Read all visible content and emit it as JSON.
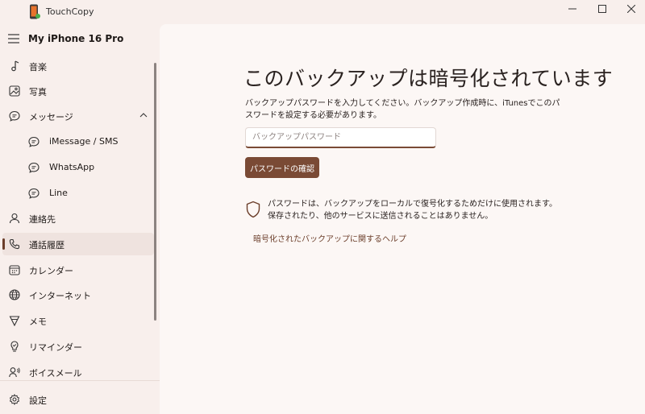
{
  "app": {
    "title": "TouchCopy"
  },
  "sidebar": {
    "device_name": "My iPhone 16 Pro",
    "items": [
      {
        "label": "音楽",
        "icon": "music-note-icon"
      },
      {
        "label": "写真",
        "icon": "photo-icon"
      },
      {
        "label": "メッセージ",
        "icon": "message-icon",
        "expanded": true
      },
      {
        "label": "iMessage / SMS",
        "icon": "chat-bubble-icon"
      },
      {
        "label": "WhatsApp",
        "icon": "chat-bubble-icon"
      },
      {
        "label": "Line",
        "icon": "chat-bubble-icon"
      },
      {
        "label": "連絡先",
        "icon": "person-icon"
      },
      {
        "label": "通話履歴",
        "icon": "phone-icon",
        "active": true
      },
      {
        "label": "カレンダー",
        "icon": "calendar-icon"
      },
      {
        "label": "インターネット",
        "icon": "globe-icon"
      },
      {
        "label": "メモ",
        "icon": "notes-icon"
      },
      {
        "label": "リマインダー",
        "icon": "reminder-icon"
      },
      {
        "label": "ボイスメール",
        "icon": "voicemail-icon"
      }
    ],
    "settings_label": "設定"
  },
  "main": {
    "heading": "このバックアップは暗号化されています",
    "description": "バックアップパスワードを入力してください。バックアップ作成時に、iTunesでこのパスワードを設定する必要があります。",
    "password_placeholder": "バックアップパスワード",
    "password_value": "",
    "confirm_button": "パスワードの確認",
    "notice": "パスワードは、バックアップをローカルで復号化するためだけに使用されます。保存されたり、他のサービスに送信されることはありません。",
    "help_link": "暗号化されたバックアップに関するヘルプ"
  },
  "colors": {
    "accent": "#7a4a35",
    "sidebar_bg": "#f8efec",
    "main_bg": "#fcf7f5"
  }
}
